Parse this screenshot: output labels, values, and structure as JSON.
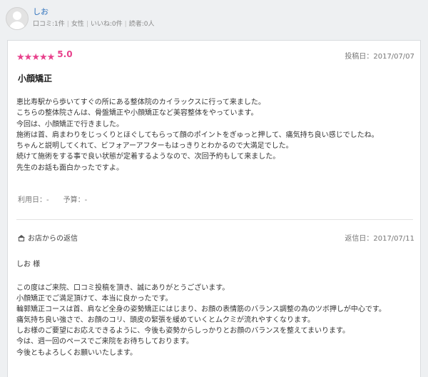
{
  "user": {
    "name": "しお",
    "stats": [
      "口コミ:1件",
      "女性",
      "いいね:0件",
      "読者:0人"
    ]
  },
  "review": {
    "rating_value": 5,
    "rating_max": 5,
    "rating_text": "5.0",
    "posted": "投稿日：2017/07/07",
    "title": "小顔矯正",
    "body": [
      "恵比寿駅から歩いてすぐの所にある整体院のカイラックスに行って来ました。",
      "こちらの整体院さんは、骨盤矯正や小顔矯正など美容整体をやっています。",
      "今回は、小顔矯正で行きました。",
      "施術は首、肩まわりをじっくりとほぐしてもらって顔のポイントをぎゅっと押して、痛気持ち良い感じでしたね。",
      "ちゃんと説明してくれて、ビフォアーアフターもはっきりとわかるので大満足でした。",
      "続けて施術をする事で良い状態が定着するようなので、次回予約もして来ました。",
      "先生のお話も面白かったですよ。"
    ],
    "usage": "利用日：-",
    "budget": "予算：-"
  },
  "reply": {
    "label": "お店からの返信",
    "date": "返信日：2017/07/11",
    "greeting": "しお 様",
    "body": [
      "この度はご来院、口コミ投稿を頂き、誠にありがとうございます。",
      "小顔矯正でご満足頂けて、本当に良かったです。",
      "輪郭矯正コースは首、肩など全身の姿勢矯正にはじまり、お顔の表情筋のバランス調整の為のツボ押しが中心です。",
      "痛気持ち良い強さで、お顔のコリ、頭皮の緊張を緩めていくとムクミが流れやすくなります。",
      "しお様のご要望にお応えできるように、今後も姿勢からしっかりとお顔のバランスを整えてまいります。",
      "今は、週一回のペースでご来院をお待ちしております。",
      "今後ともよろしくお願いいたします。"
    ]
  },
  "colors": {
    "accent": "#e8418c",
    "link": "#2a6ebb"
  }
}
